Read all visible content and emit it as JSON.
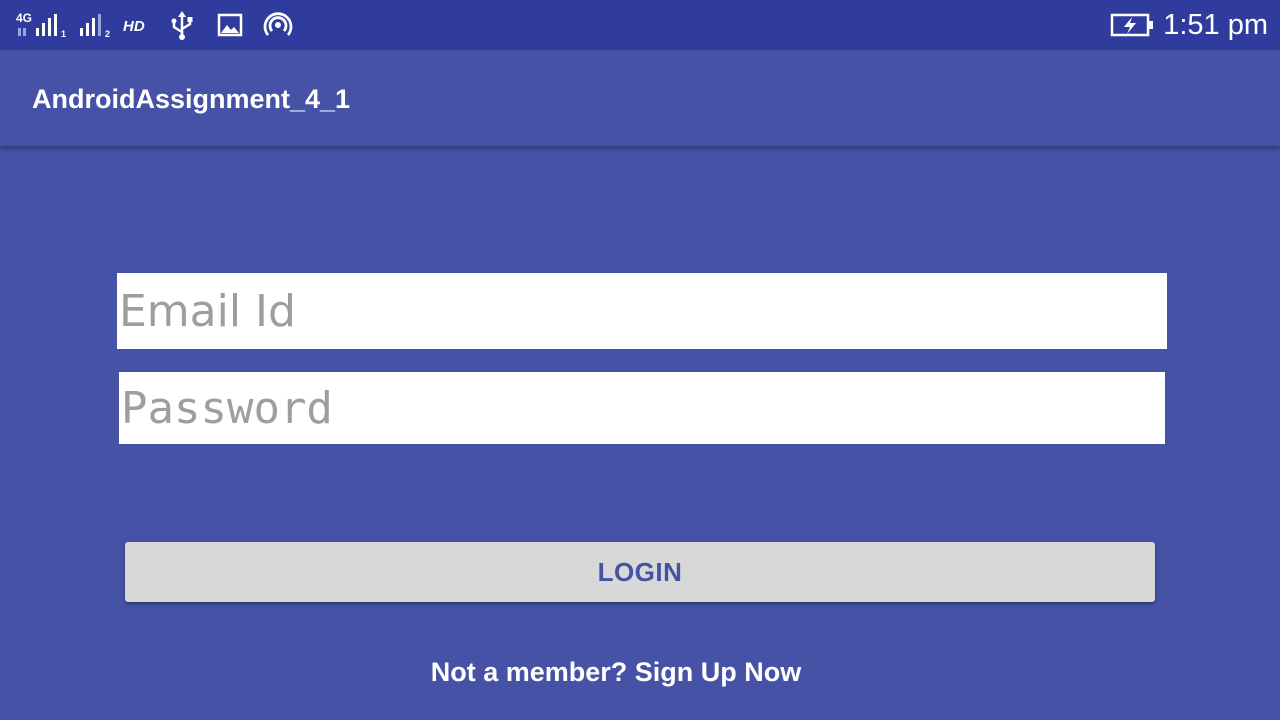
{
  "status_bar": {
    "network_label": "4G",
    "sim1_label": "1",
    "sim2_label": "2",
    "hd_label": "HD",
    "time": "1:51 pm",
    "icons": [
      "signal-sim1-icon",
      "signal-sim2-icon",
      "hd-icon",
      "usb-icon",
      "image-icon",
      "hotspot-icon",
      "battery-charging-icon"
    ]
  },
  "toolbar": {
    "title": "AndroidAssignment_4_1"
  },
  "form": {
    "email_placeholder": "Email Id",
    "password_placeholder": "Password",
    "login_label": "LOGIN",
    "signup_text": "Not a member? Sign Up Now"
  },
  "colors": {
    "status_bar": "#2f3c9e",
    "primary": "#4552a5",
    "button_bg": "#d7d8d8",
    "button_text": "#4552a5"
  }
}
